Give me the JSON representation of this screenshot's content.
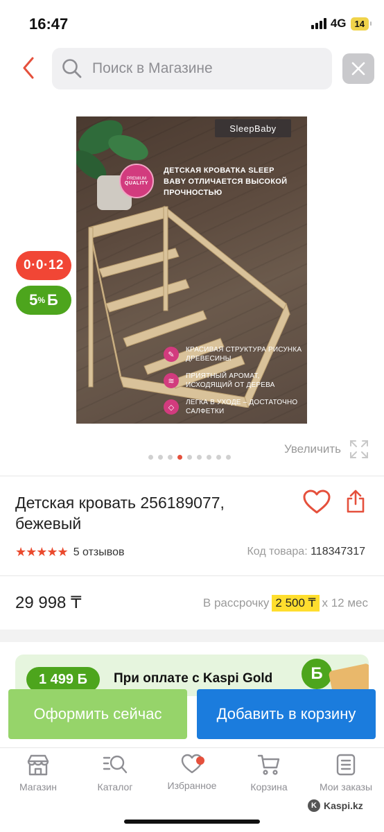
{
  "status_bar": {
    "time": "16:47",
    "network": "4G",
    "battery": "14"
  },
  "header": {
    "search_placeholder": "Поиск в Магазине"
  },
  "product_image": {
    "brand": "SleepBaby",
    "quality_badge_top": "PREMIUM",
    "quality_badge_text": "QUALITY",
    "headline": "Детская кроватка Sleep Baby отличается высокой прочностью",
    "features": [
      {
        "icon": "fingerprint-icon",
        "text": "Красивая структура рисунка древесины"
      },
      {
        "icon": "aroma-icon",
        "text": "Приятный аромат, исходящий от дерева"
      },
      {
        "icon": "diamond-icon",
        "text": "Легка в уходе – достаточно салфетки"
      }
    ],
    "dots_count": 9,
    "active_dot": 3
  },
  "badges": {
    "installment": "0·0·12",
    "bonus_value": "5",
    "bonus_unit": "%",
    "bonus_symbol": "Б"
  },
  "zoom_label": "Увеличить",
  "product": {
    "title": "Детская кровать 256189077, бежевый",
    "rating": 5,
    "stars": "★★★★★",
    "reviews": "5 отзывов",
    "sku_label": "Код товара:",
    "sku": "118347317",
    "price": "29 998 ₸",
    "installment_label": "В рассрочку",
    "installment_amount": "2 500 ₸",
    "installment_term": "х 12 мес"
  },
  "promo": {
    "amount": "1 499 Б",
    "text": "При оплате с Kaspi Gold",
    "coin": "Б"
  },
  "actions": {
    "buy_now": "Оформить сейчас",
    "add_to_cart": "Добавить в корзину"
  },
  "nav": [
    {
      "label": "Магазин",
      "icon": "store-icon"
    },
    {
      "label": "Каталог",
      "icon": "catalog-search-icon"
    },
    {
      "label": "Избранное",
      "icon": "heart-icon"
    },
    {
      "label": "Корзина",
      "icon": "cart-icon"
    },
    {
      "label": "Мои заказы",
      "icon": "orders-icon"
    }
  ],
  "watermark": "Kaspi.kz",
  "colors": {
    "accent_red": "#e5503c",
    "kaspi_green": "#4da51d",
    "buy_button": "#96d46a",
    "cart_button": "#1b7cdd",
    "installment_highlight": "#ffde2e"
  }
}
